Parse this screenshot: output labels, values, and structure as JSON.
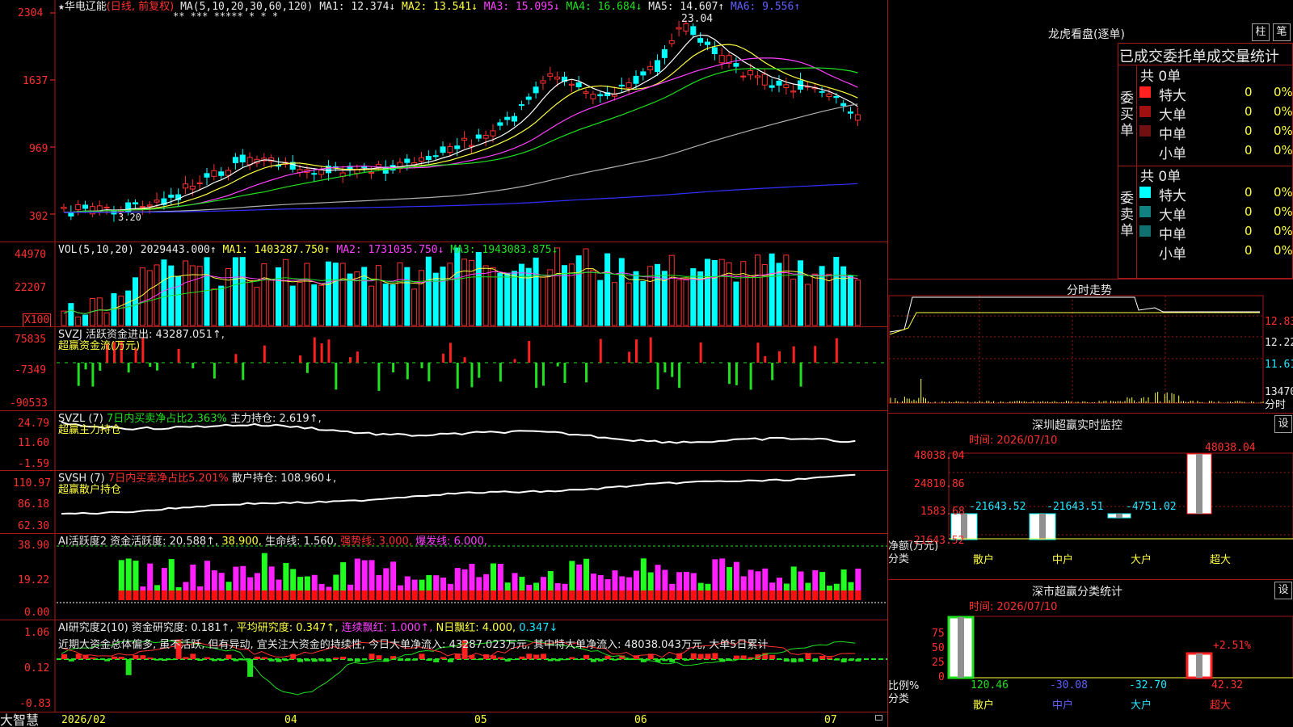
{
  "app_name": "大智慧",
  "stock": {
    "star": "★",
    "name": "华电辽能",
    "mode": "(日线, 前复权)"
  },
  "main": {
    "ma_label": "MA(5,10,20,30,60,120)",
    "ma1": "MA1: 12.374↓",
    "ma2": "MA2: 13.541↓",
    "ma3": "MA3: 15.095↓",
    "ma4": "MA4: 16.684↓",
    "ma5": "MA5: 14.607↑",
    "ma6": "MA6: 9.556↑",
    "axis": [
      "2304",
      "1637",
      "969",
      "302"
    ],
    "high_label": "23.04",
    "low_label": "3.20",
    "stars": "**  ***  *****   *   *     *"
  },
  "vol": {
    "label": "VOL(5,10,20)",
    "value": "2029443.000↑",
    "ma1": "MA1: 1403287.750↑",
    "ma2": "MA2: 1731035.750↓",
    "ma3": "MA3: 1943083.875↓",
    "axis": [
      "44970",
      "22207",
      "X100"
    ]
  },
  "svzj": {
    "label": "SVZJ",
    "desc": "活跃资金进出: 43287.051↑,",
    "sub": "超赢资金流(万元)",
    "axis": [
      "75835",
      "-7349",
      "-90533"
    ]
  },
  "svzl": {
    "label": "SVZL (7)",
    "desc1": "7日内买卖净占比2.363%",
    "desc2": "主力持仓: 2.619↑,",
    "sub": "超赢主力持仓",
    "axis": [
      "24.79",
      "11.60",
      "-1.59"
    ]
  },
  "svsh": {
    "label": "SVSH (7)",
    "desc1": "7日内买卖净占比5.201%",
    "desc2": "散户持仓: 108.960↓,",
    "sub": "超赢散户持仓",
    "axis": [
      "110.97",
      "86.18",
      "62.30"
    ]
  },
  "ai1": {
    "label": "AI活跃度2",
    "d1": "资金活跃度: 20.588↑,",
    "d2": "38.900,",
    "d3": "生命线: 1.560,",
    "d4": "强势线: 3.000,",
    "d5": "爆发线: 6.000,",
    "axis": [
      "38.90",
      "19.22",
      "0.00"
    ]
  },
  "ai2": {
    "label": "AI研究度2(10)",
    "d1": "资金研究度: 0.181↑,",
    "d2": "平均研究度: 0.347↑,",
    "d3": "连续飘红: 1.000↑,",
    "d4": "N日飘红: 4.000,",
    "d5": "0.347↓",
    "text": "近期大资金总体偏多, 虽不活跃, 但有异动, 宜关注大资金的持续性, 今日大单净流入: 43287.023万元, 其中特大单净流入: 48038.043万元, 大单5日累计",
    "axis": [
      "1.06",
      "0.12",
      "-0.83"
    ]
  },
  "dates": [
    "2026/02",
    "04",
    "05",
    "06",
    "07"
  ],
  "longhu": {
    "title": "龙虎看盘(逐单)",
    "btn1": "柱",
    "btn2": "笔",
    "tabs": "已成交委托单成交量统计",
    "buy": {
      "label": "委买单",
      "total": "共 0单",
      "rows": [
        {
          "name": "特大",
          "count": "0",
          "pct": "0%",
          "color": "#ff2020"
        },
        {
          "name": "大单",
          "count": "0",
          "pct": "0%",
          "color": "#a01010"
        },
        {
          "name": "中单",
          "count": "0",
          "pct": "0%",
          "color": "#701010"
        },
        {
          "name": "小单",
          "count": "0",
          "pct": "0%",
          "color": "#000000"
        }
      ]
    },
    "sell": {
      "label": "委卖单",
      "total": "共 0单",
      "rows": [
        {
          "name": "特大",
          "count": "0",
          "pct": "0%",
          "color": "#00ffff"
        },
        {
          "name": "大单",
          "count": "0",
          "pct": "0%",
          "color": "#108080"
        },
        {
          "name": "中单",
          "count": "0",
          "pct": "0%",
          "color": "#107070"
        },
        {
          "name": "小单",
          "count": "0",
          "pct": "0%",
          "color": "#000000"
        }
      ]
    }
  },
  "fenshi": {
    "title": "分时走势",
    "axis": [
      "12.83",
      "12.22",
      "11.61",
      "13470",
      "分时"
    ]
  },
  "monitor": {
    "title": "深圳超赢实时监控",
    "btn": "设",
    "time": "时间: 2026/07/10",
    "axis": [
      "48038.04",
      "24810.86",
      "1583.68",
      "-21643.52"
    ],
    "values": [
      "-21643.52",
      "-21643.51",
      "-4751.02",
      "48038.04"
    ],
    "ylabel": "净额(万元)",
    "xlabel": "分类",
    "cats": [
      "散户",
      "中户",
      "大户",
      "超大"
    ]
  },
  "classify": {
    "title": "深市超赢分类统计",
    "btn": "设",
    "time": "时间: 2026/07/10",
    "axis": [
      "75",
      "50",
      "25",
      "0"
    ],
    "values": [
      "120.46",
      "-30.08",
      "-32.70",
      "42.32"
    ],
    "pct": "+2.51%",
    "ylabel": "比例%",
    "xlabel": "分类",
    "cats": [
      "散户",
      "中户",
      "大户",
      "超大"
    ]
  }
}
